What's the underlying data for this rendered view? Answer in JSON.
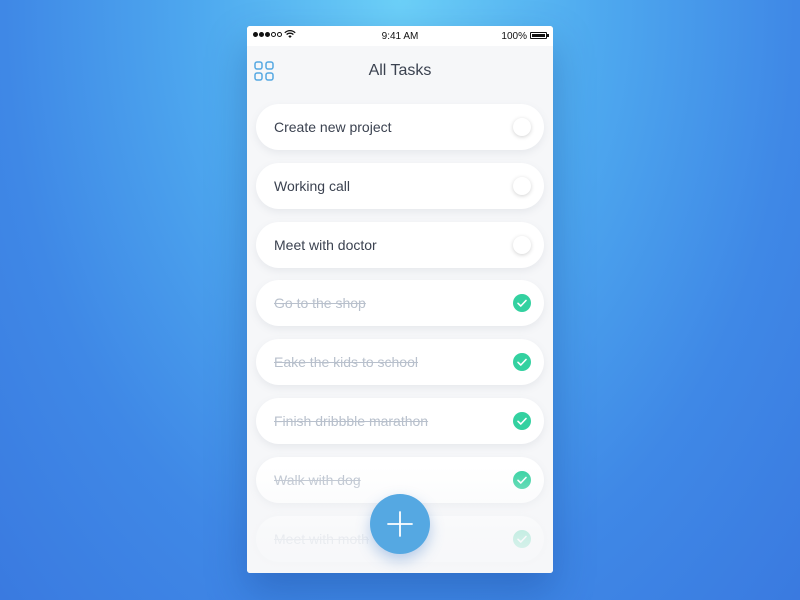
{
  "status_bar": {
    "time": "9:41 AM",
    "battery": "100%"
  },
  "header": {
    "title": "All Tasks",
    "menu_icon": "grid-icon"
  },
  "tasks": [
    {
      "label": "Create new project",
      "completed": false
    },
    {
      "label": "Working call",
      "completed": false
    },
    {
      "label": "Meet with doctor",
      "completed": false
    },
    {
      "label": "Go to the shop",
      "completed": true
    },
    {
      "label": "Eake the kids to school",
      "completed": true
    },
    {
      "label": "Finish dribbble marathon",
      "completed": true
    },
    {
      "label": "Walk with dog",
      "completed": true
    },
    {
      "label": "Meet with moth",
      "completed": true
    }
  ],
  "fab": {
    "icon": "plus-icon"
  },
  "colors": {
    "accent": "#55a8e2",
    "check": "#33d1a0",
    "text": "#3b4250",
    "text_done": "#b8c0cc"
  }
}
